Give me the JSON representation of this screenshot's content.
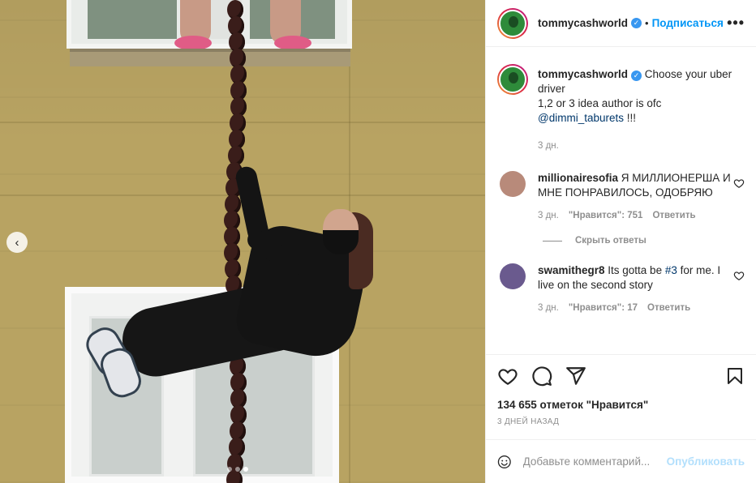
{
  "post": {
    "author": "tommycashworld",
    "verified_icon": "verified-badge-icon",
    "follow_sep": "•",
    "follow_label": "Подписаться",
    "more_label": "•••"
  },
  "caption": {
    "username": "tommycashworld",
    "text_line1": " Choose your uber driver",
    "text_line2": "1,2 or 3 idea author is ofc",
    "mention": "@dimmi_taburets",
    "text_end": " !!!",
    "time": "3 дн."
  },
  "comments": [
    {
      "username": "millionairesofia",
      "text": " Я МИЛЛИОНЕРША И МНЕ ПОНРАВИЛОСЬ, ОДОБРЯЮ",
      "time": "3 дн.",
      "likes": "\"Нравится\": 751",
      "reply": "Ответить",
      "avatar_color": "#b88a7a"
    },
    {
      "username": "swamithegr8",
      "text_before": " Its gotta be ",
      "hashtag": "#3",
      "text_after": " for me. I live on the second story",
      "time": "3 дн.",
      "likes": "\"Нравится\": 17",
      "reply": "Ответить",
      "avatar_color": "#6a5a8e"
    }
  ],
  "hide_replies": "Скрыть ответы",
  "actions": {
    "icons": [
      "heart-icon",
      "comment-icon",
      "share-icon",
      "bookmark-icon"
    ]
  },
  "likes_count": "134 655 отметок \"Нравится\"",
  "date": "3 ДНЕЙ НАЗАД",
  "composer": {
    "placeholder": "Добавьте комментарий...",
    "post_label": "Опубликовать",
    "emoji_icon": "emoji-icon"
  },
  "carousel": {
    "prev_icon": "chevron-left-icon",
    "prev_label": "‹",
    "slide_count": 3,
    "active_index": 2
  },
  "colors": {
    "accent": "#0095f6",
    "post_disabled": "#b2dffc",
    "muted": "#8e8e8e",
    "mention": "#00376b"
  }
}
